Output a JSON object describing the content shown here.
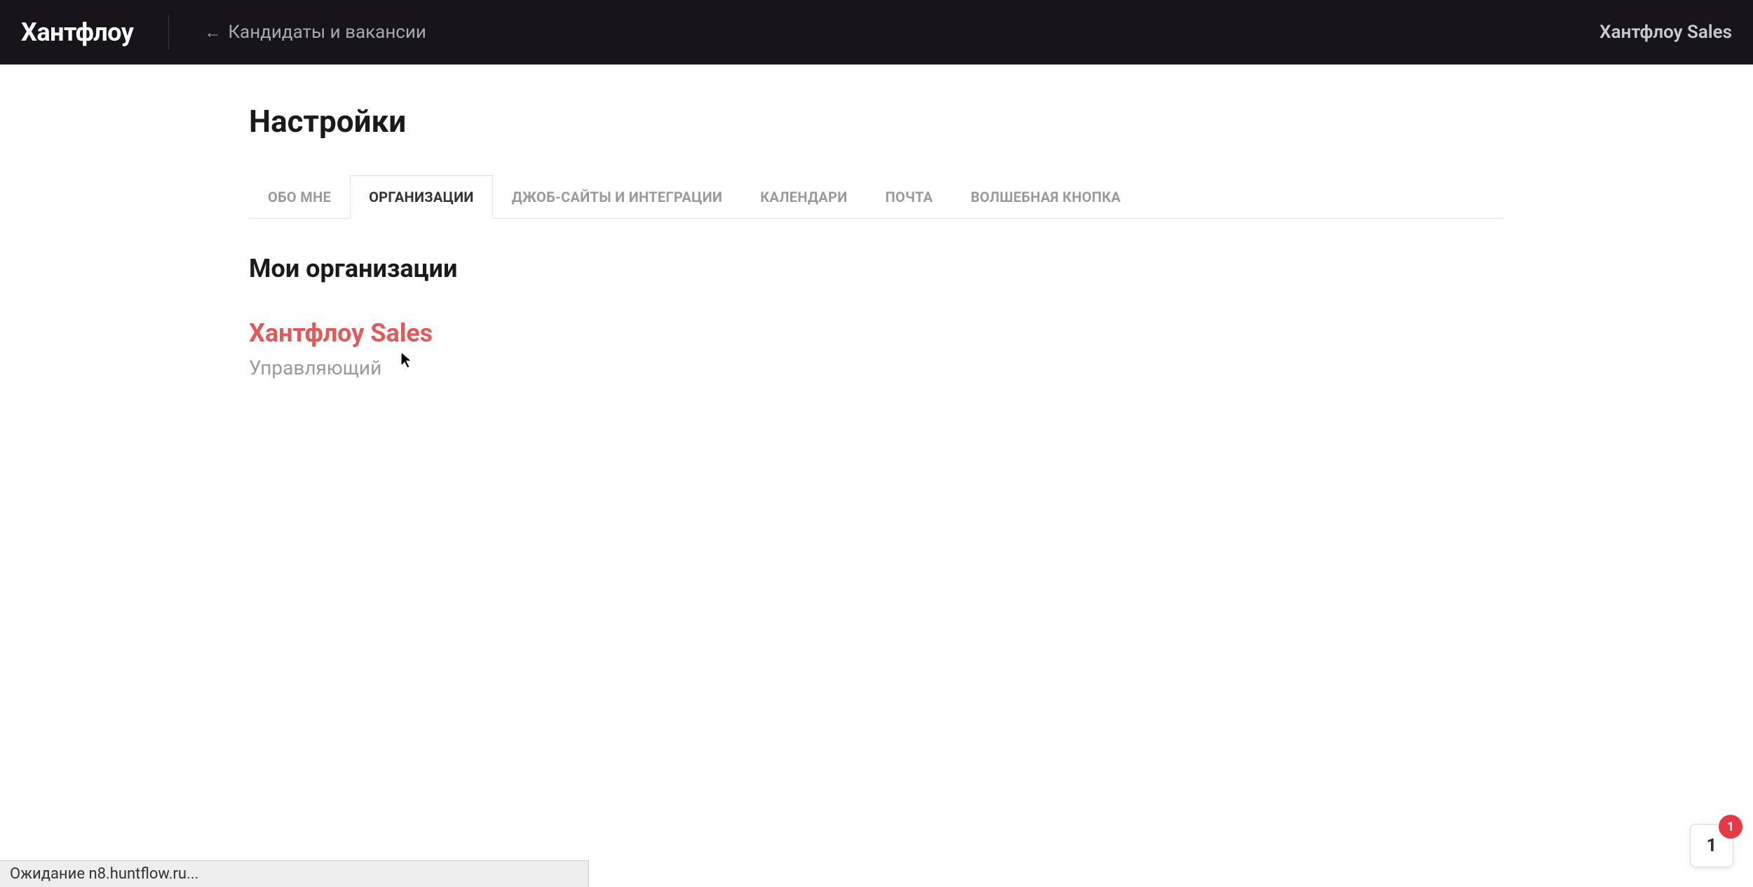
{
  "header": {
    "logo": "Хантфлоу",
    "back_link": "Кандидаты и вакансии",
    "account_name": "Хантфлоу Sales"
  },
  "page": {
    "title": "Настройки",
    "section_title": "Мои организации"
  },
  "tabs": [
    {
      "label": "ОБО МНЕ",
      "active": false
    },
    {
      "label": "ОРГАНИЗАЦИИ",
      "active": true
    },
    {
      "label": "ДЖОБ-САЙТЫ И ИНТЕГРАЦИИ",
      "active": false
    },
    {
      "label": "КАЛЕНДАРИ",
      "active": false
    },
    {
      "label": "ПОЧТА",
      "active": false
    },
    {
      "label": "ВОЛШЕБНАЯ КНОПКА",
      "active": false
    }
  ],
  "organization": {
    "name": "Хантфлоу Sales",
    "role": "Управляющий"
  },
  "chat": {
    "count": "1",
    "badge": "1"
  },
  "status_bar": {
    "text": "Ожидание n8.huntflow.ru..."
  }
}
